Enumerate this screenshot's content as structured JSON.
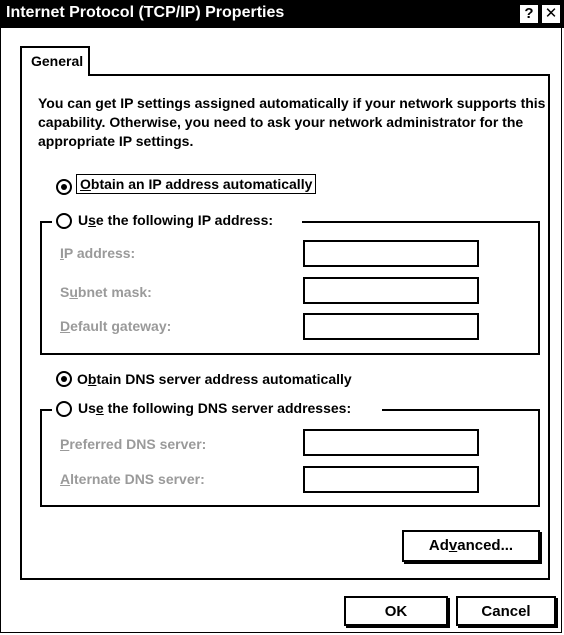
{
  "window": {
    "title": "Internet Protocol (TCP/IP) Properties",
    "help_label": "?",
    "close_label": "✕"
  },
  "tabs": [
    {
      "label": "General",
      "selected": true
    }
  ],
  "intro_text": "You can get IP settings assigned automatically if your network supports this capability. Otherwise, you need to ask your network administrator for the appropriate IP settings.",
  "ip": {
    "auto": {
      "pre": "",
      "mnemonic": "O",
      "post": "btain an IP address automatically",
      "checked": true
    },
    "manual": {
      "pre": "U",
      "mnemonic": "s",
      "post": "e the following IP address:",
      "checked": false
    },
    "fields": [
      {
        "pre": "",
        "mnemonic": "I",
        "post": "P address:",
        "value": ""
      },
      {
        "pre": "S",
        "mnemonic": "u",
        "post": "bnet mask:",
        "value": ""
      },
      {
        "pre": "",
        "mnemonic": "D",
        "post": "efault gateway:",
        "value": ""
      }
    ]
  },
  "dns": {
    "auto": {
      "pre": "O",
      "mnemonic": "b",
      "post": "tain DNS server address automatically",
      "checked": true
    },
    "manual": {
      "pre": "Us",
      "mnemonic": "e",
      "post": " the following DNS server addresses:",
      "checked": false
    },
    "fields": [
      {
        "pre": "",
        "mnemonic": "P",
        "post": "referred DNS server:",
        "value": ""
      },
      {
        "pre": "",
        "mnemonic": "A",
        "post": "lternate DNS server:",
        "value": ""
      }
    ]
  },
  "buttons": {
    "advanced": {
      "pre": "Ad",
      "mnemonic": "v",
      "post": "anced..."
    },
    "ok": "OK",
    "cancel": "Cancel"
  }
}
